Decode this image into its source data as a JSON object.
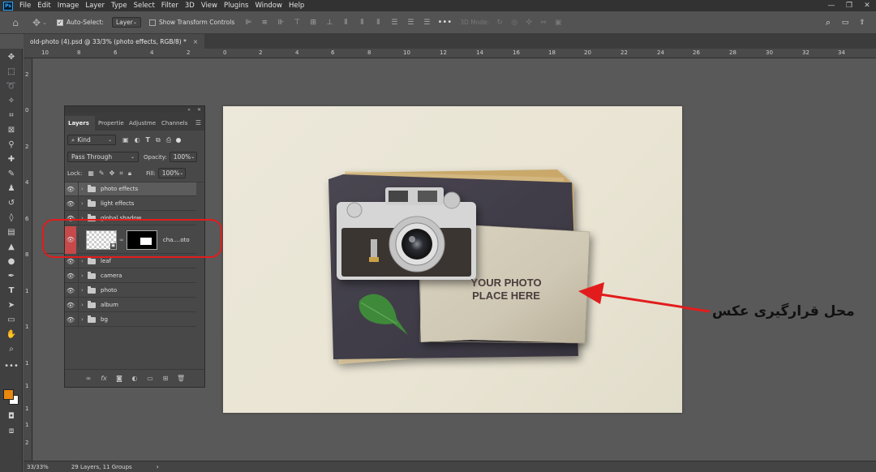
{
  "menubar": {
    "logo": "Ps",
    "items": [
      "File",
      "Edit",
      "Image",
      "Layer",
      "Type",
      "Select",
      "Filter",
      "3D",
      "View",
      "Plugins",
      "Window",
      "Help"
    ]
  },
  "options": {
    "auto_select_label": "Auto-Select:",
    "auto_select_target": "Layer",
    "show_transform_label": "Show Transform Controls",
    "three_d_mode_label": "3D Mode:"
  },
  "document_tab": {
    "title": "old-photo (4).psd @ 33/3% (photo effects, RGB/8) *",
    "close": "×"
  },
  "ruler": {
    "top_ticks": [
      "10",
      "8",
      "6",
      "4",
      "2",
      "0",
      "2",
      "4",
      "6",
      "8",
      "10",
      "12",
      "14",
      "16",
      "18",
      "20",
      "22",
      "24",
      "26",
      "28",
      "30",
      "32",
      "34"
    ],
    "left_ticks": [
      "2",
      "0",
      "2",
      "4",
      "6",
      "8",
      "1",
      "1",
      "1",
      "1",
      "1",
      "1",
      "2"
    ]
  },
  "layers_panel": {
    "tabs": [
      "Layers",
      "Propertie",
      "Adjustme",
      "Channels"
    ],
    "filter_kind": "Kind",
    "blend_mode": "Pass Through",
    "opacity_label": "Opacity:",
    "opacity_value": "100%",
    "lock_label": "Lock:",
    "fill_label": "Fill:",
    "fill_value": "100%",
    "layers": [
      {
        "name": "photo effects",
        "selected": true
      },
      {
        "name": "light effects"
      },
      {
        "name": "global shadow"
      },
      {
        "name": "cha....oto"
      },
      {
        "name": "leaf"
      },
      {
        "name": "camera"
      },
      {
        "name": "photo"
      },
      {
        "name": "album"
      },
      {
        "name": "bg"
      }
    ]
  },
  "canvas": {
    "placeholder_line1": "YOUR PHOTO",
    "placeholder_line2": "PLACE HERE",
    "annotation_fa": "محل قرارگیری عکس"
  },
  "status": {
    "zoom": "33/33%",
    "info": "29 Layers, 11 Groups",
    "arrow": "›"
  },
  "colors": {
    "foreground": "#e8880f",
    "background": "#ffffff",
    "annotation_red": "#e21c1c",
    "ps_blue": "#31a8ff"
  }
}
